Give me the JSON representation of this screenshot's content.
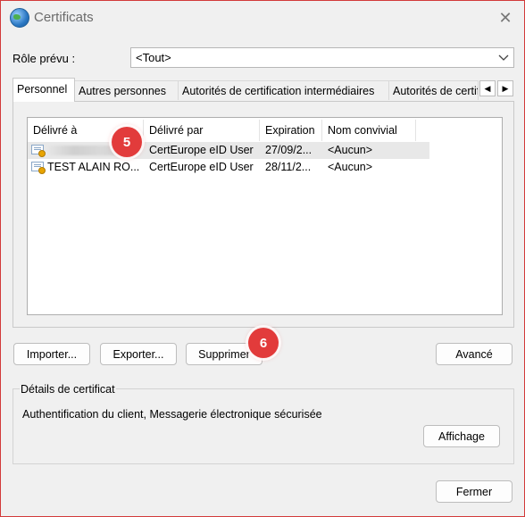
{
  "window": {
    "title": "Certificats",
    "close_glyph": "✕"
  },
  "role": {
    "label": "Rôle prévu :",
    "selected": "<Tout>"
  },
  "tabs": [
    {
      "label": "Personnel"
    },
    {
      "label": "Autres personnes"
    },
    {
      "label": "Autorités de certification intermédiaires"
    },
    {
      "label": "Autorités de certifi"
    }
  ],
  "tab_scroll": {
    "left": "◀",
    "right": "▶"
  },
  "table": {
    "columns": [
      "Délivré à",
      "Délivré par",
      "Expiration",
      "Nom convivial"
    ],
    "rows": [
      {
        "issued_to": "",
        "issued_by": "CertEurope eID User",
        "expiration": "27/09/2...",
        "friendly_name": "<Aucun>"
      },
      {
        "issued_to": "TEST ALAIN RO...",
        "issued_by": "CertEurope eID User",
        "expiration": "28/11/2...",
        "friendly_name": "<Aucun>"
      }
    ]
  },
  "buttons": {
    "import": "Importer...",
    "export": "Exporter...",
    "delete": "Supprimer",
    "advanced": "Avancé",
    "view": "Affichage",
    "close": "Fermer"
  },
  "details": {
    "group_label": "Détails de certificat",
    "text": "Authentification du client, Messagerie électronique sécurisée"
  },
  "badges": [
    "5",
    "6"
  ],
  "colors": {
    "badge": "#e23b3b",
    "window_border": "#d23a3a"
  }
}
